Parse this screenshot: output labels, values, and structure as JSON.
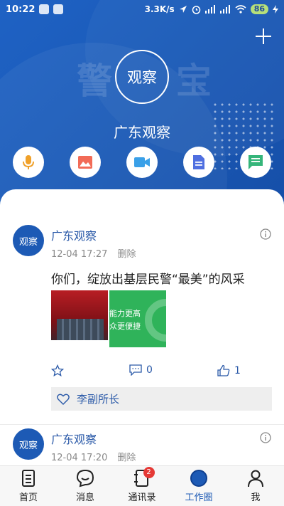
{
  "status_bar": {
    "time": "10:22",
    "speed": "3.3K/s",
    "battery": "86"
  },
  "header": {
    "watermark_left": "警",
    "watermark_right": "宝",
    "logo_text": "观察",
    "org_name": "广东观察",
    "quick_actions": [
      {
        "name": "voice",
        "icon": "microphone-icon",
        "color": "#f0a12a"
      },
      {
        "name": "image",
        "icon": "image-icon",
        "color": "#f26b57"
      },
      {
        "name": "video",
        "icon": "video-camera-icon",
        "color": "#3aa0e8"
      },
      {
        "name": "document",
        "icon": "document-icon",
        "color": "#4f6fe0"
      },
      {
        "name": "message",
        "icon": "message-icon",
        "color": "#35b57a"
      }
    ]
  },
  "posts": [
    {
      "avatar_text": "观察",
      "author": "广东观察",
      "time": "12-04 17:27",
      "delete_label": "删除",
      "content": "你们，绽放出基层民警“最美”的风采",
      "thumb2_lines": [
        "能力更高",
        "众更便捷"
      ],
      "comment_count": "0",
      "like_count": "1",
      "liked_by": "李副所长"
    },
    {
      "avatar_text": "观察",
      "author": "广东观察",
      "time": "12-04 17:20",
      "delete_label": "删除"
    }
  ],
  "bottom_nav": [
    {
      "label": "首页",
      "icon": "home-document-icon",
      "active": false
    },
    {
      "label": "消息",
      "icon": "message-bubble-icon",
      "active": false
    },
    {
      "label": "通讯录",
      "icon": "contacts-book-icon",
      "active": false,
      "badge": "2"
    },
    {
      "label": "工作圈",
      "icon": "work-circle-icon",
      "active": true
    },
    {
      "label": "我",
      "icon": "person-icon",
      "active": false
    }
  ],
  "colors": {
    "brand_blue": "#1d5ab5",
    "link_blue": "#2a59a8",
    "badge_red": "#e53935"
  }
}
